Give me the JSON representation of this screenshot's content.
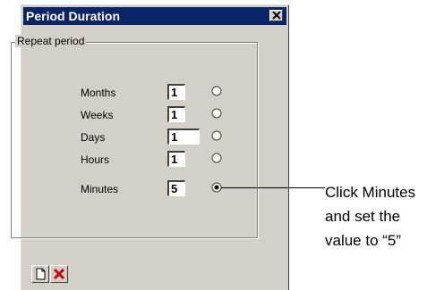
{
  "window": {
    "title": "Period Duration"
  },
  "group": {
    "label": "Repeat period"
  },
  "rows": [
    {
      "label": "Months",
      "value": "1",
      "selected": false
    },
    {
      "label": "Weeks",
      "value": "1",
      "selected": false
    },
    {
      "label": "Days",
      "value": "1",
      "selected": false
    },
    {
      "label": "Hours",
      "value": "1",
      "selected": false
    },
    {
      "label": "Minutes",
      "value": "5",
      "selected": true
    }
  ],
  "callout": {
    "line1": "Click Minutes",
    "line2": "and set the",
    "line3": "value to “5”"
  },
  "toolbar": {
    "icons": [
      "new-document-icon",
      "delete-icon"
    ],
    "delete_color": "#cc0000"
  },
  "colors": {
    "titlebar": "#0a246a",
    "dialog": "#d4d0c8"
  }
}
